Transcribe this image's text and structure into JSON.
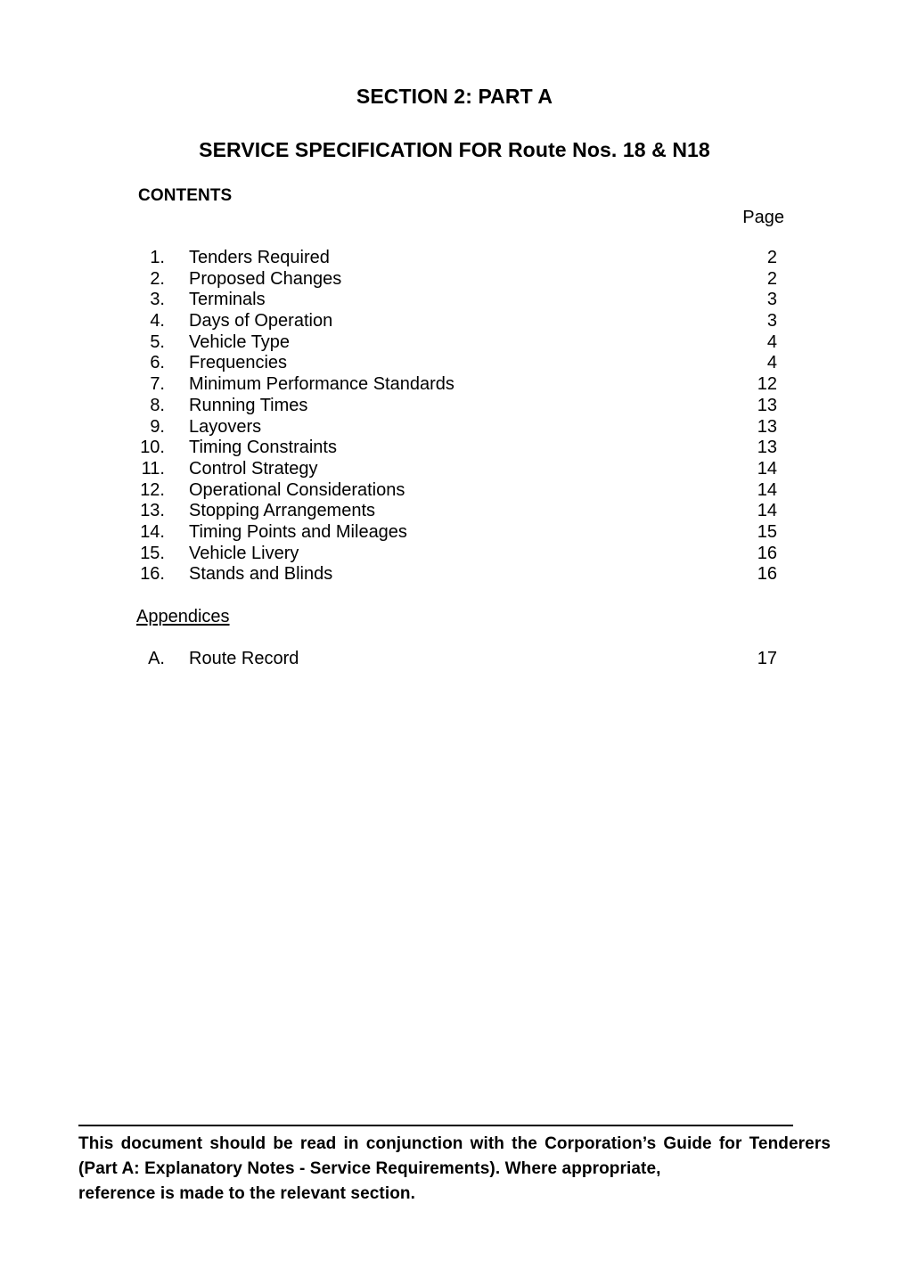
{
  "document": {
    "title_main": "SECTION 2: PART A",
    "title_sub": "SERVICE SPECIFICATION FOR Route Nos. 18 & N18",
    "contents_label": "CONTENTS",
    "page_column_header": "Page",
    "appendices_heading": "Appendices"
  },
  "contents": [
    {
      "number": "1.",
      "label": "Tenders Required",
      "page": "2"
    },
    {
      "number": "2.",
      "label": "Proposed Changes",
      "page": "2"
    },
    {
      "number": "3.",
      "label": "Terminals",
      "page": "3"
    },
    {
      "number": "4.",
      "label": "Days of Operation",
      "page": "3"
    },
    {
      "number": "5.",
      "label": "Vehicle Type",
      "page": "4"
    },
    {
      "number": "6.",
      "label": "Frequencies",
      "page": "4"
    },
    {
      "number": "7.",
      "label": "Minimum Performance Standards",
      "page": "12"
    },
    {
      "number": "8.",
      "label": "Running Times",
      "page": "13"
    },
    {
      "number": "9.",
      "label": "Layovers",
      "page": "13"
    },
    {
      "number": "10.",
      "label": "Timing Constraints",
      "page": "13"
    },
    {
      "number": "11.",
      "label": "Control Strategy",
      "page": "14"
    },
    {
      "number": "12.",
      "label": "Operational Considerations",
      "page": "14"
    },
    {
      "number": "13.",
      "label": "Stopping Arrangements",
      "page": "14"
    },
    {
      "number": "14.",
      "label": "Timing Points and Mileages",
      "page": "15"
    },
    {
      "number": "15.",
      "label": "Vehicle Livery",
      "page": "16"
    },
    {
      "number": "16.",
      "label": "Stands and Blinds",
      "page": "16"
    }
  ],
  "appendices": [
    {
      "number": "A.",
      "label": "Route Record",
      "page": "17"
    }
  ],
  "footer": {
    "text": "This document should be read in conjunction with the Corporation’s Guide for Tenderers (Part A: Explanatory Notes - Service Requirements). Where appropriate,",
    "last_line": "reference is made to the relevant section."
  }
}
